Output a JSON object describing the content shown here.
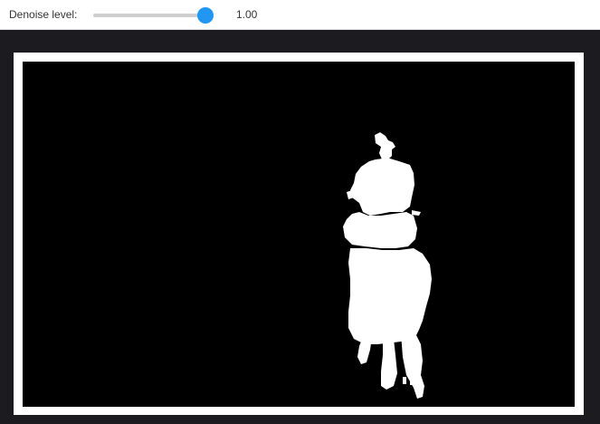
{
  "denoise": {
    "label": "Denoise level:",
    "value": 1.0,
    "value_text": "1.00",
    "min": 0.0,
    "max": 1.0
  },
  "colors": {
    "toolbar_bg": "#ffffff",
    "viewer_bg": "#1c1b20",
    "slider_thumb": "#2196f3",
    "slider_track": "#cfcfcf",
    "mask_background": "#000000",
    "mask_foreground": "#ffffff"
  },
  "mask_image": {
    "subject": "rider-on-horse-silhouette"
  }
}
